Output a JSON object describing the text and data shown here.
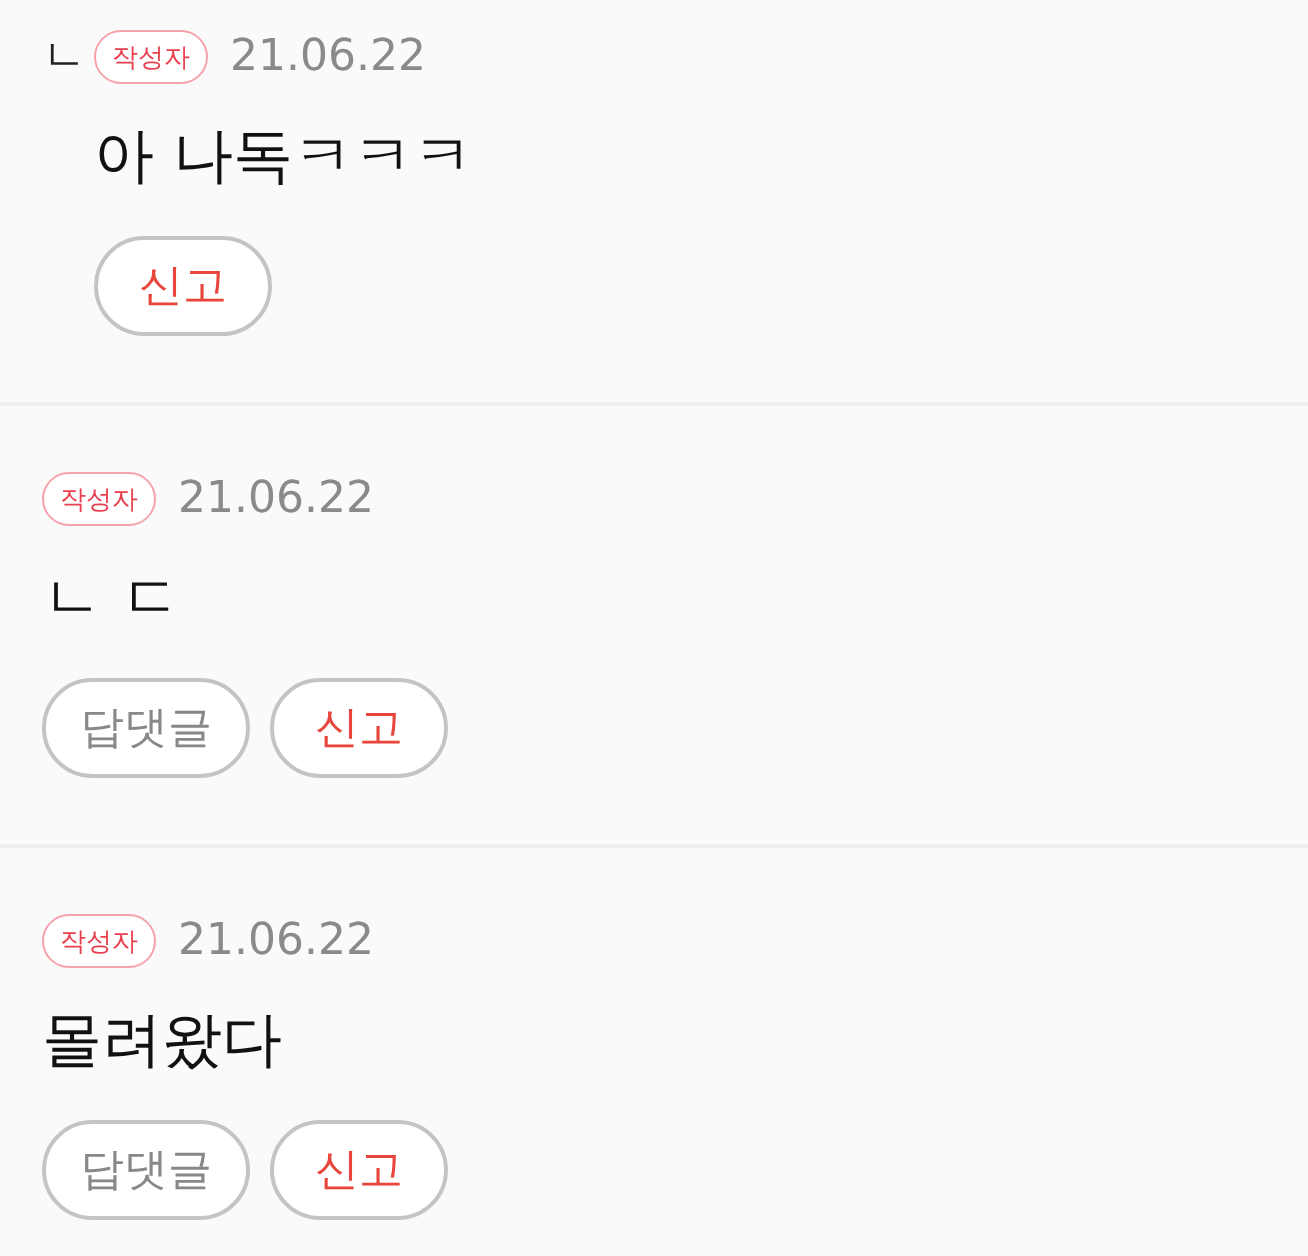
{
  "comments": [
    {
      "reply_marker": "ㄴ",
      "badge": "작성자",
      "date": "21.06.22",
      "body": "아 나독ㅋㅋㅋ",
      "actions": [
        {
          "kind": "report",
          "label": "신고"
        }
      ]
    },
    {
      "badge": "작성자",
      "date": "21.06.22",
      "body": "ㄴ ㄷ",
      "actions": [
        {
          "kind": "reply",
          "label": "답댓글"
        },
        {
          "kind": "report",
          "label": "신고"
        }
      ]
    },
    {
      "badge": "작성자",
      "date": "21.06.22",
      "body": "몰려왔다",
      "actions": [
        {
          "kind": "reply",
          "label": "답댓글"
        },
        {
          "kind": "report",
          "label": "신고"
        }
      ]
    }
  ]
}
